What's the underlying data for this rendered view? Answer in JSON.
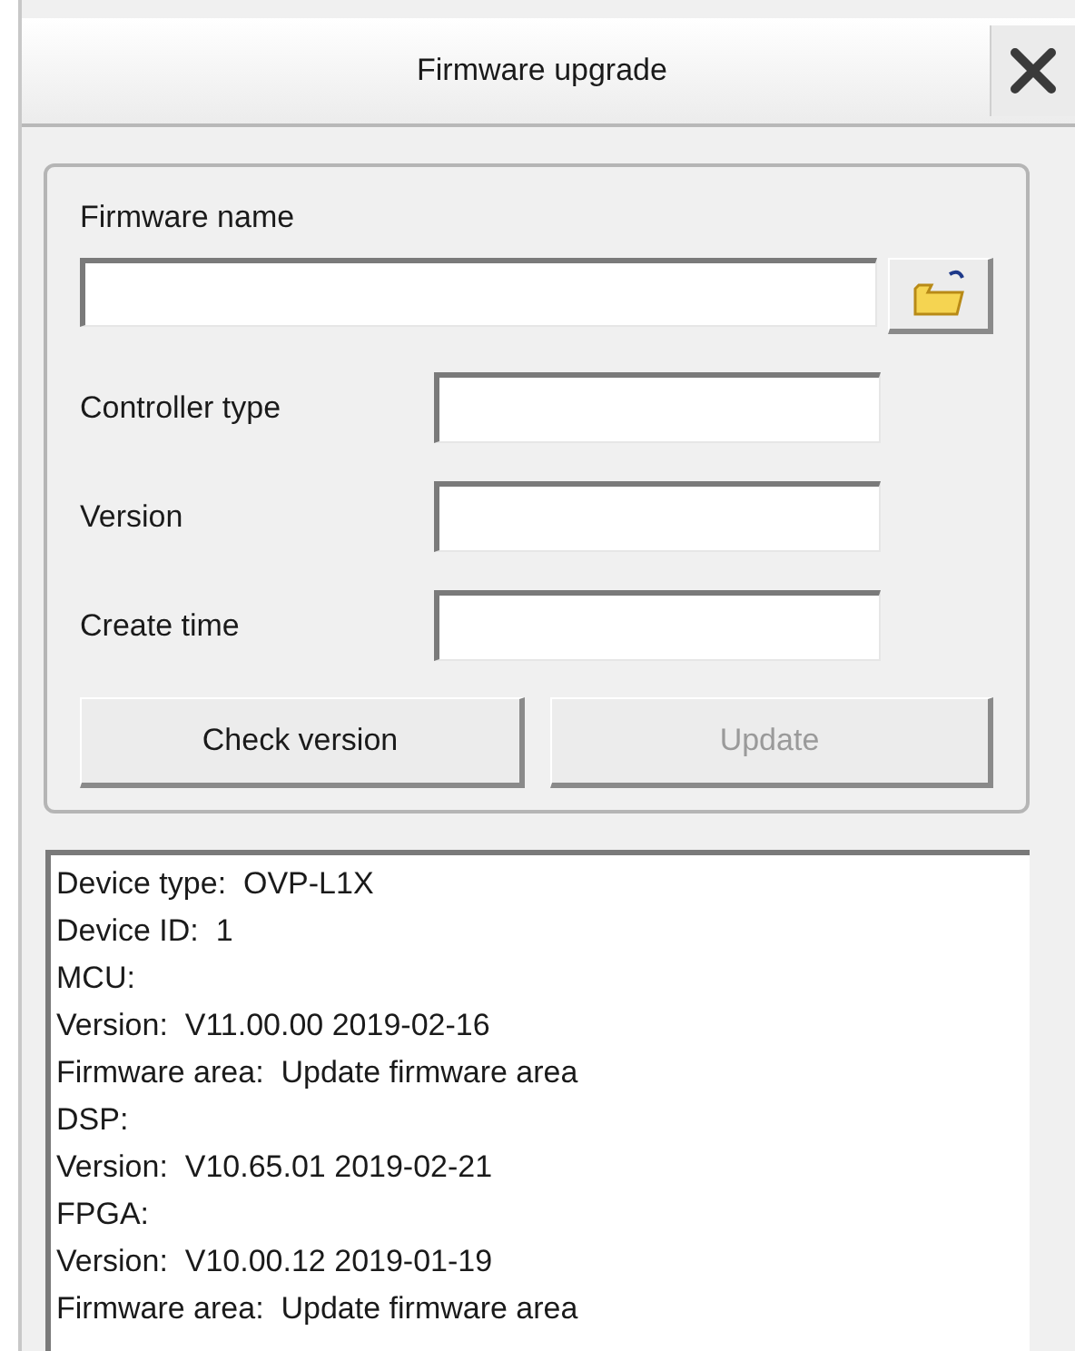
{
  "window": {
    "title": "Firmware upgrade"
  },
  "firmware_name": {
    "label": "Firmware name"
  },
  "fields": [
    {
      "label": "Controller type"
    },
    {
      "label": "Version"
    },
    {
      "label": "Create time"
    }
  ],
  "buttons": [
    {
      "label": "Check version",
      "disabled": false
    },
    {
      "label": "Update",
      "disabled": true
    }
  ],
  "log": [
    "Device type:  OVP-L1X",
    "Device ID:  1",
    "MCU:",
    "Version:  V11.00.00 2019-02-16",
    "Firmware area:  Update firmware area",
    "DSP:",
    "Version:  V10.65.01 2019-02-21",
    "FPGA:",
    "Version:  V10.00.12 2019-01-19",
    "Firmware area:  Update firmware area"
  ]
}
